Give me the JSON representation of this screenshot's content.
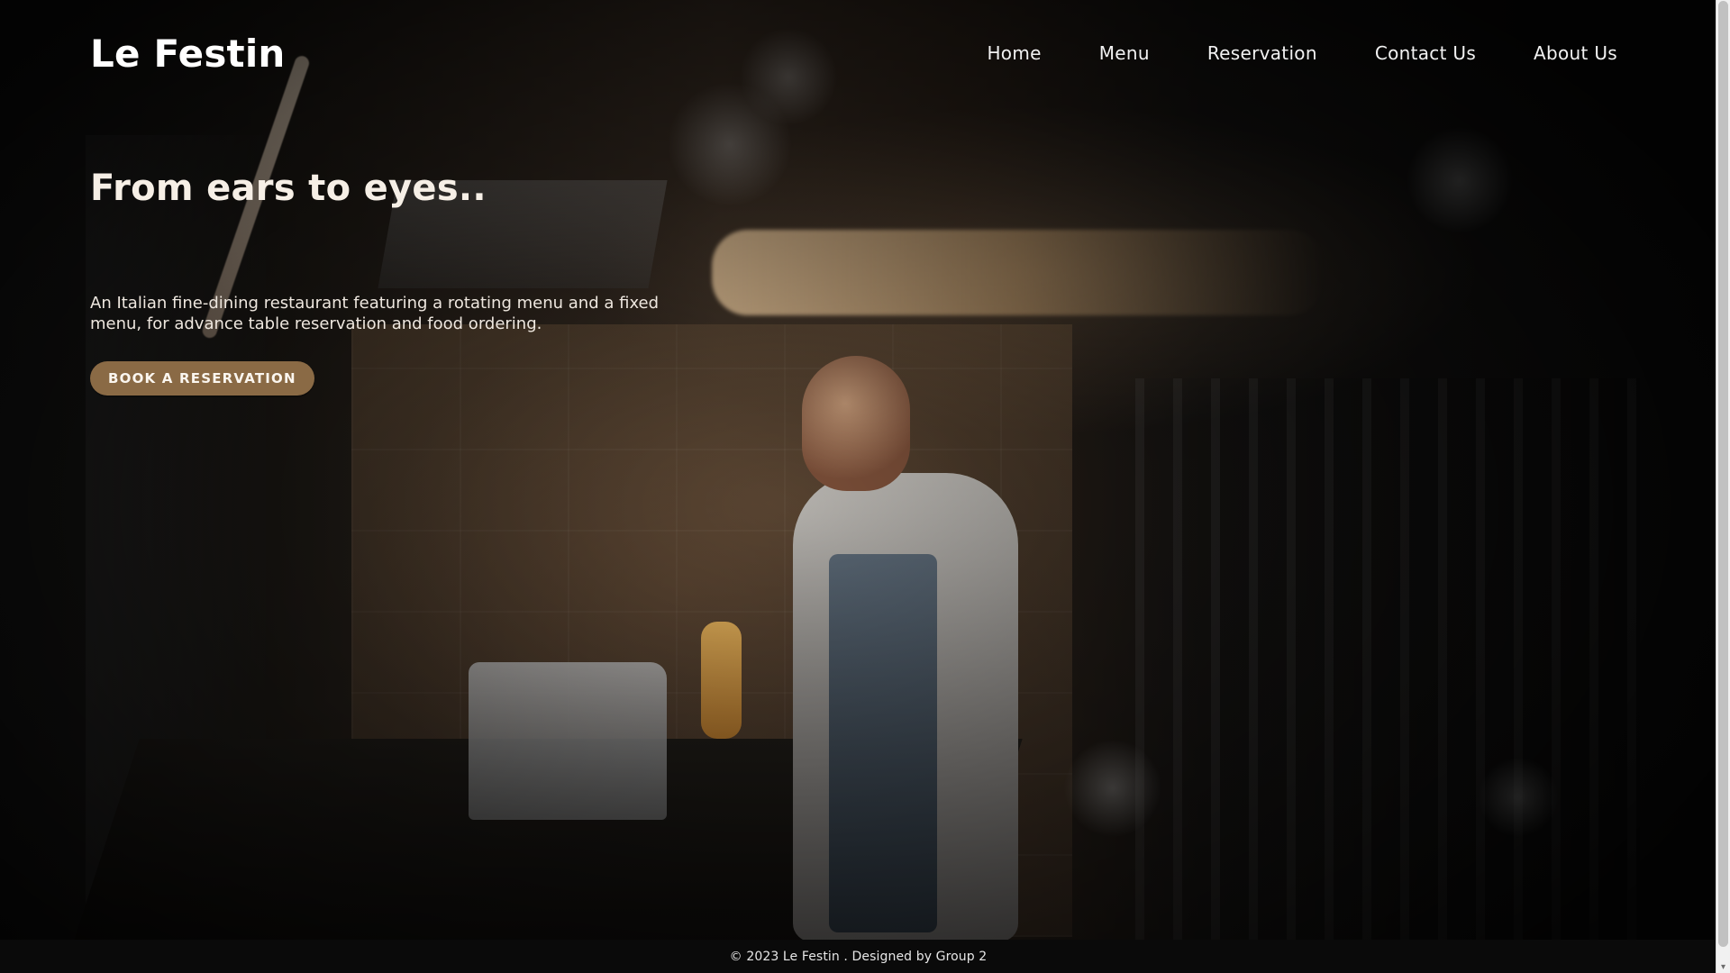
{
  "site": {
    "brand": "Le Festin"
  },
  "nav": {
    "items": [
      {
        "label": "Home"
      },
      {
        "label": "Menu"
      },
      {
        "label": "Reservation"
      },
      {
        "label": "Contact Us"
      },
      {
        "label": "About Us"
      }
    ]
  },
  "hero": {
    "title": "From ears to eyes..",
    "description": "An Italian fine-dining restaurant featuring a rotating menu and a fixed menu, for advance table reservation and food ordering.",
    "cta_label": "BOOK A RESERVATION"
  },
  "footer": {
    "text": "© 2023 Le Festin . Designed by Group 2"
  },
  "ui": {
    "colors": {
      "cta_bg": "#8a6a45",
      "footer_bg": "#0a0a0a"
    },
    "icons": {
      "scroll_down": "chevron-down-icon"
    }
  }
}
